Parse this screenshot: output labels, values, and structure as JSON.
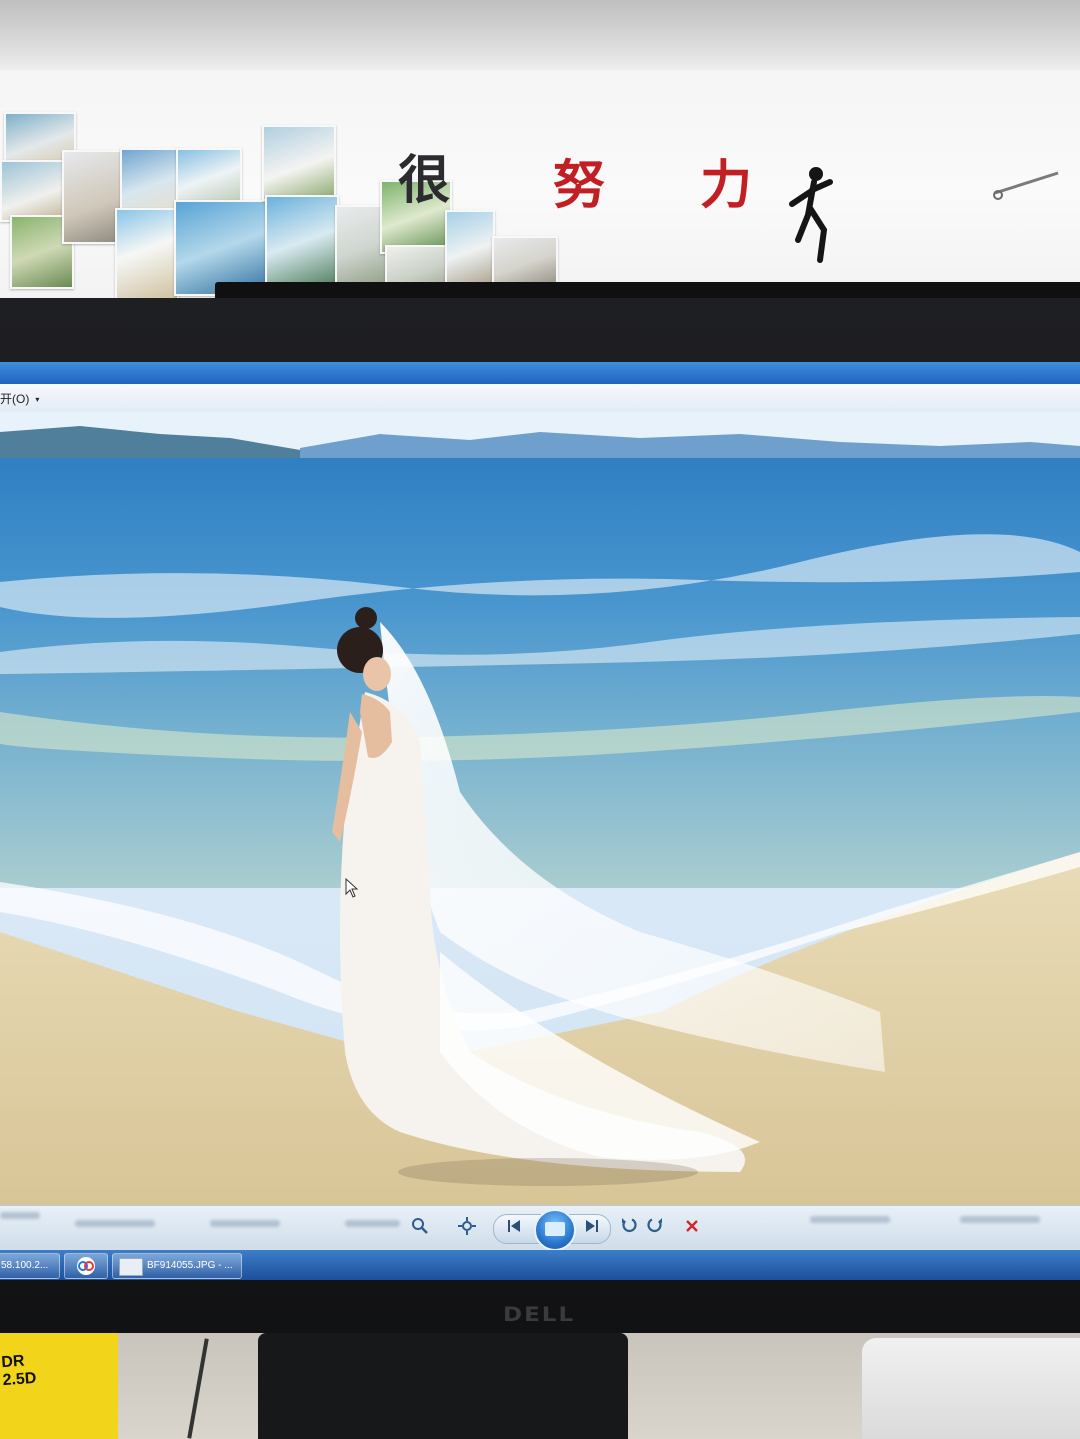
{
  "wall": {
    "slogan": [
      "很",
      "努",
      "力"
    ]
  },
  "viewer": {
    "open_menu_label": "开(O)",
    "open_menu_arrow": "▾",
    "controls": {
      "zoom_icon": "magnifier-icon",
      "fit_icon": "actual-size-icon",
      "prev_icon": "previous-icon",
      "slideshow_icon": "slideshow-icon",
      "next_icon": "next-icon",
      "rotate_ccw_icon": "rotate-counterclockwise-icon",
      "rotate_cw_icon": "rotate-clockwise-icon",
      "delete_icon": "delete-icon"
    }
  },
  "taskbar": {
    "items": [
      {
        "label": "58.100.2..."
      },
      {
        "label": ""
      },
      {
        "label": "BF914055.JPG - ..."
      }
    ]
  },
  "monitor": {
    "brand": "DELL"
  },
  "desk": {
    "book_text": "DR\n2.5D"
  },
  "colors": {
    "slogan_red": "#c21f24",
    "taskbar_blue": "#1c4f9a",
    "sea": "#3f8ec8",
    "sand": "#e2d3ad",
    "book_yellow": "#f2d51a"
  }
}
